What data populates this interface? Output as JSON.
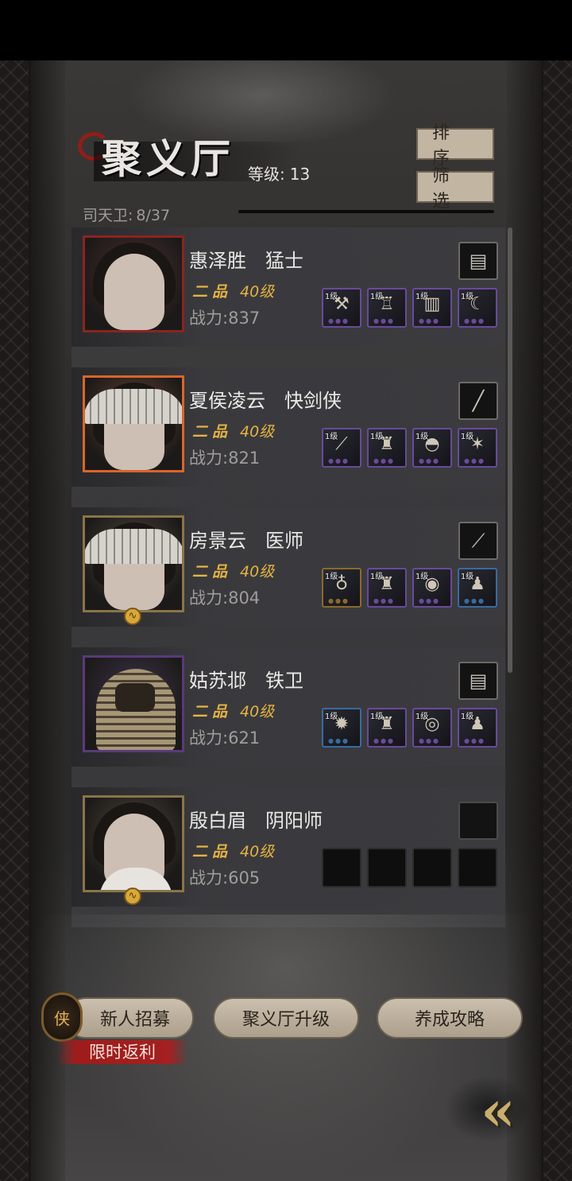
{
  "header": {
    "title": "聚义厅",
    "level_label": "等级:",
    "level_value": "13",
    "sort_label": "排序",
    "filter_label": "筛选",
    "guard_label": "司天卫:",
    "guard_count": "8/37"
  },
  "heroes": [
    {
      "name": "惠泽胜",
      "class": "猛士",
      "rank": "二品",
      "level": "40级",
      "power_label": "战力:",
      "power": "837",
      "frame_color": "#8a2420",
      "portrait": "woman-dark-hair",
      "weapon_icon": "comb-icon",
      "weapon_glyph": "▤",
      "equipment": [
        {
          "level": "1级",
          "icon": "mace-icon",
          "glyph": "⚒",
          "frame": "#6a4a9a",
          "gems": "●●●"
        },
        {
          "level": "1级",
          "icon": "robe-icon",
          "glyph": "♖",
          "frame": "#6a4a9a",
          "gems": "●●●"
        },
        {
          "level": "1级",
          "icon": "bracer-icon",
          "glyph": "▥",
          "frame": "#6a4a9a",
          "gems": "●●●"
        },
        {
          "level": "1级",
          "icon": "horn-icon",
          "glyph": "☾",
          "frame": "#6a4a9a",
          "gems": "●●●"
        }
      ]
    },
    {
      "name": "夏侯凌云",
      "class": "快剑侠",
      "rank": "二品",
      "level": "40级",
      "power_label": "战力:",
      "power": "821",
      "frame_color": "#d9652a",
      "portrait": "woman-straw-hat",
      "weapon_icon": "sword-icon",
      "weapon_glyph": "╱",
      "equipment": [
        {
          "level": "1级",
          "icon": "blade-icon",
          "glyph": "⟋",
          "frame": "#6a4a9a",
          "gems": "●●●"
        },
        {
          "level": "1级",
          "icon": "armor-icon",
          "glyph": "♜",
          "frame": "#6a4a9a",
          "gems": "●●●"
        },
        {
          "level": "1级",
          "icon": "helmet-icon",
          "glyph": "◓",
          "frame": "#6a4a9a",
          "gems": "●●●"
        },
        {
          "level": "1级",
          "icon": "trinket-icon",
          "glyph": "✶",
          "frame": "#6a4a9a",
          "gems": "●●●"
        }
      ]
    },
    {
      "name": "房景云",
      "class": "医师",
      "rank": "二品",
      "level": "40级",
      "power_label": "战力:",
      "power": "804",
      "frame_color": "#8a7448",
      "portrait": "woman-veil-hat",
      "weapon_icon": "spear-icon",
      "weapon_glyph": "⟋",
      "equipment": [
        {
          "level": "1级",
          "icon": "gourd-icon",
          "glyph": "♁",
          "frame": "#8a6a2a",
          "gems": "●●●"
        },
        {
          "level": "1级",
          "icon": "armor-icon",
          "glyph": "♜",
          "frame": "#6a4a9a",
          "gems": "●●●"
        },
        {
          "level": "1级",
          "icon": "orb-icon",
          "glyph": "◉",
          "frame": "#6a4a9a",
          "gems": "●●●"
        },
        {
          "level": "1级",
          "icon": "pouch-icon",
          "glyph": "♟",
          "frame": "#3a6aa0",
          "gems": "●●●"
        }
      ]
    },
    {
      "name": "姑苏邶",
      "class": "铁卫",
      "rank": "二品",
      "level": "40级",
      "power_label": "战力:",
      "power": "621",
      "frame_color": "#5a3a7a",
      "portrait": "armored-warrior",
      "weapon_icon": "comb-icon",
      "weapon_glyph": "▤",
      "equipment": [
        {
          "level": "1级",
          "icon": "flail-icon",
          "glyph": "✹",
          "frame": "#3a6aa0",
          "gems": "●●●"
        },
        {
          "level": "1级",
          "icon": "armor-icon",
          "glyph": "♜",
          "frame": "#6a4a9a",
          "gems": "●●●"
        },
        {
          "level": "1级",
          "icon": "shield-icon",
          "glyph": "◎",
          "frame": "#6a4a9a",
          "gems": "●●●"
        },
        {
          "level": "1级",
          "icon": "pouch-icon",
          "glyph": "♟",
          "frame": "#6a4a9a",
          "gems": "●●●"
        }
      ]
    },
    {
      "name": "殷白眉",
      "class": "阴阳师",
      "rank": "二品",
      "level": "40级",
      "power_label": "战力:",
      "power": "605",
      "frame_color": "#8a7448",
      "portrait": "man-white-robe",
      "weapon_icon": "empty-slot-icon",
      "weapon_glyph": "",
      "equipment": [
        {
          "level": "",
          "icon": "empty-slot-icon",
          "glyph": "",
          "frame": "#2e2c2b",
          "gems": ""
        },
        {
          "level": "",
          "icon": "empty-slot-icon",
          "glyph": "",
          "frame": "#2e2c2b",
          "gems": ""
        },
        {
          "level": "",
          "icon": "empty-slot-icon",
          "glyph": "",
          "frame": "#2e2c2b",
          "gems": ""
        },
        {
          "level": "",
          "icon": "empty-slot-icon",
          "glyph": "",
          "frame": "#2e2c2b",
          "gems": ""
        }
      ]
    }
  ],
  "footer": {
    "recruit_label": "新人招募",
    "recruit_badge_glyph": "侠",
    "promo_label": "限时返利",
    "upgrade_label": "聚义厅升级",
    "guide_label": "养成攻略",
    "back_glyph": "«"
  },
  "colors": {
    "gold": "#e4b343",
    "promo_red": "#a52020",
    "button_tan": "#c2b5a2"
  }
}
